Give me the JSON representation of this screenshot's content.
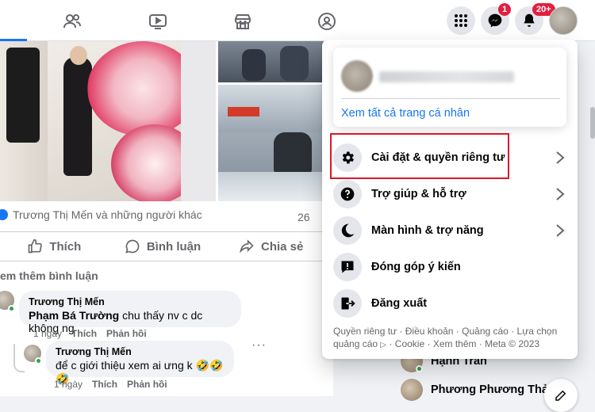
{
  "topbar": {
    "nav_icons": [
      "friends-icon",
      "watch-icon",
      "marketplace-icon",
      "groups-icon"
    ],
    "messenger_badge": "1",
    "notifications_badge": "20+"
  },
  "post": {
    "reactions_text": "Trương Thị Mến và những người khác",
    "comment_count": "26",
    "actions": {
      "like": "Thích",
      "comment": "Bình luận",
      "share": "Chia sẻ"
    },
    "see_more_comments": "em thêm bình luận"
  },
  "comments": [
    {
      "author": "Trương Thị Mến",
      "mention": "Phạm Bá Trường",
      "text": " chu thấy nv c dc không ng",
      "time": "1 ngày",
      "like": "Thích",
      "reply": "Phản hồi"
    },
    {
      "author": "Trương Thị Mến",
      "text": "để c giới thiệu xem ai ưng k 🤣🤣🤣",
      "time": "1 ngày",
      "like": "Thích",
      "reply": "Phản hồi"
    }
  ],
  "contacts": [
    "Hạnh Trần",
    "Phương Phương Thảo"
  ],
  "menu": {
    "see_all_profiles": "Xem tất cả trang cá nhân",
    "items": [
      {
        "label": "Cài đặt & quyền riêng tư",
        "icon": "gear-icon",
        "has_chevron": true
      },
      {
        "label": "Trợ giúp & hỗ trợ",
        "icon": "help-icon",
        "has_chevron": true
      },
      {
        "label": "Màn hình & trợ năng",
        "icon": "moon-icon",
        "has_chevron": true
      },
      {
        "label": "Đóng góp ý kiến",
        "icon": "feedback-icon",
        "has_chevron": false
      },
      {
        "label": "Đăng xuất",
        "icon": "logout-icon",
        "has_chevron": false
      }
    ],
    "footer": {
      "privacy": "Quyền riêng tư",
      "terms": "Điều khoản",
      "ads": "Quảng cáo",
      "ad_choices": "Lựa chọn quảng cáo",
      "cookie": "Cookie",
      "more": "Xem thêm",
      "copyright": "Meta © 2023",
      "sep": " · "
    }
  },
  "colors": {
    "accent": "#1877f2",
    "highlight_border": "#e0162b",
    "badge": "#e41e3f"
  }
}
